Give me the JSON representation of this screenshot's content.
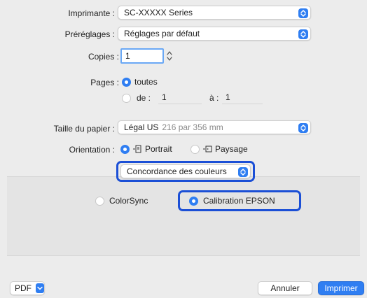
{
  "printer": {
    "label": "Imprimante :",
    "value": "SC-XXXXX Series"
  },
  "presets": {
    "label": "Préréglages :",
    "value": "Réglages par défaut"
  },
  "copies": {
    "label": "Copies :",
    "value": "1"
  },
  "pages": {
    "label": "Pages :",
    "all_label": "toutes",
    "from_label": "de :",
    "from_value": "1",
    "to_label": "à :",
    "to_value": "1"
  },
  "paper_size": {
    "label": "Taille du papier :",
    "value": "Légal US",
    "detail": "216 par 356 mm"
  },
  "orientation": {
    "label": "Orientation :",
    "portrait": "Portrait",
    "landscape": "Paysage"
  },
  "section_popup": {
    "value": "Concordance des couleurs"
  },
  "color_matching": {
    "colorsync": "ColorSync",
    "epson": "Calibration EPSON",
    "selected": "Calibration EPSON"
  },
  "footer": {
    "pdf": "PDF",
    "cancel": "Annuler",
    "print": "Imprimer"
  },
  "colors": {
    "accent": "#2f7ef2",
    "highlight": "#1b4fd6"
  }
}
